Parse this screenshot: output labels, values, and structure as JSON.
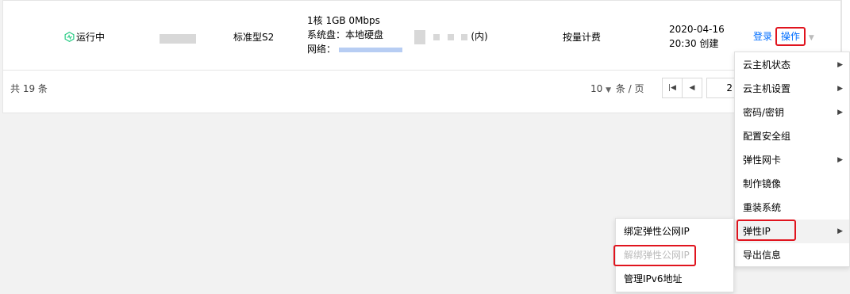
{
  "instance_row": {
    "status": "运行中",
    "spec": "标准型S2",
    "config_line1": "1核 1GB 0Mbps",
    "config_disk_label": "系统盘：",
    "config_disk_value": "本地硬盘",
    "config_network_label": "网络：",
    "ip_suffix": "(内)",
    "billing": "按量计费",
    "created_date": "2020-04-16",
    "created_time": "20:30 创建",
    "login_label": "登录",
    "operate_label": "操作"
  },
  "footer": {
    "total": "共 19 条",
    "page_size": "10",
    "per_page_label": "条 / 页",
    "current_page": "2"
  },
  "operate_menu": {
    "items": [
      {
        "label": "云主机状态",
        "submenu": true
      },
      {
        "label": "云主机设置",
        "submenu": true
      },
      {
        "label": "密码/密钥",
        "submenu": true
      },
      {
        "label": "配置安全组",
        "submenu": false
      },
      {
        "label": "弹性网卡",
        "submenu": true
      },
      {
        "label": "制作镜像",
        "submenu": false
      },
      {
        "label": "重装系统",
        "submenu": false
      },
      {
        "label": "弹性IP",
        "submenu": true
      },
      {
        "label": "导出信息",
        "submenu": false
      }
    ]
  },
  "eip_submenu": {
    "items": [
      {
        "label": "绑定弹性公网IP",
        "disabled": false
      },
      {
        "label": "解绑弹性公网IP",
        "disabled": true
      },
      {
        "label": "管理IPv6地址",
        "disabled": false
      }
    ]
  },
  "colors": {
    "accent": "#006eff",
    "status_green": "#29cc85",
    "highlight": "#e0141e"
  },
  "icons": {
    "status": "running-status-icon",
    "submenu": "caret-right-icon",
    "dropdown": "caret-down-icon",
    "first_page": "first-page-icon",
    "prev_page": "prev-page-icon"
  }
}
